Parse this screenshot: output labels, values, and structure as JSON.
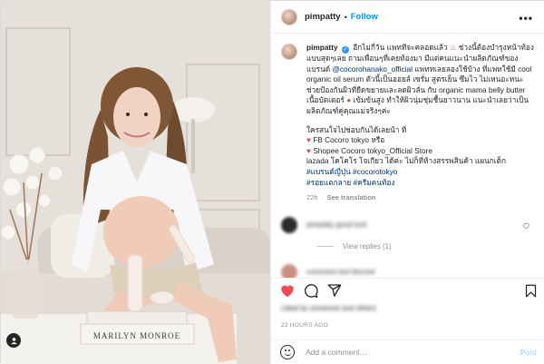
{
  "post": {
    "author": "pimpatty",
    "follow_label": "Follow",
    "dot": "•",
    "more_label": "•••",
    "verified_glyph": "✓",
    "photo_text": "MARILYN MONROE",
    "caption": {
      "line1": "อีกไม่กี่วัน แพททีจะคลอดแล้ว",
      "line1b": " ช่วงนี้ต้องบำรุงหน้าท้องแบบสุดๆเลย",
      "line2": " ถามเพื่อนๆที่เคยท้องมา มีแต่คนแนะนำผลิตภัณฑ์ของแบรนด์ ",
      "mention": "@cocorohanako_official",
      "line3": " แพททเลยลองใช้บ้าง ที่แพทใช้มี cool organic oil serum ตัวนี้เป็นออยล์ เซรั่ม สูตรเย็น ซึมไว ไม่เหนอะหนะ ช่วยป้องกันผิวที่ยืดขยายและลดผิวลั่น กับ organic mama belly butter เนื้อบัตเตอร์",
      "line4": " เข้มข้นสูง ทำให้ผิวนุ่มชุ่มชื้นยาวนาน แนะนำเลยว่าเป็นผลิตภัณฑ์คู่คุณแม่จริงๆค่ะ",
      "intro": "ใครสนใจไปช่อบกันได้เลยน้า ที่",
      "shop1": " FB Cocoro tokyo หรือ",
      "shop2": " Shopee Cocoro tokyo_Official Store",
      "shop3": "lazada โคโคโร โจเกียว ได้ค่ะ ไม่ก็ที่ห้างสรรพสินค้า แผนกเด็ก",
      "hashtags1": "#แบรนด์ญี่ปุ่น #cocorotokyo",
      "hashtags2": "#รอยแตกลาย #ครีมคนท้อง",
      "time": "22h",
      "see_translation": "See translation"
    },
    "comment1_text": "pimpatty good luck",
    "view_replies": "View replies (1)",
    "comment2_text": "comment text blurred",
    "likes_text": "Liked by someone and others",
    "timestamp": "22 HOURS AGO",
    "add_comment_placeholder": "Add a comment…",
    "post_button": "Post"
  },
  "colors": {
    "link_blue": "#0095f6",
    "hashtag": "#00376b",
    "heart_red": "#ed4956",
    "pink_emoji": "#e4407e"
  },
  "icons": [
    "user-tag-icon",
    "more-options-icon",
    "heart-icon",
    "comment-icon",
    "share-icon",
    "bookmark-icon",
    "emoji-icon",
    "verified-icon"
  ]
}
